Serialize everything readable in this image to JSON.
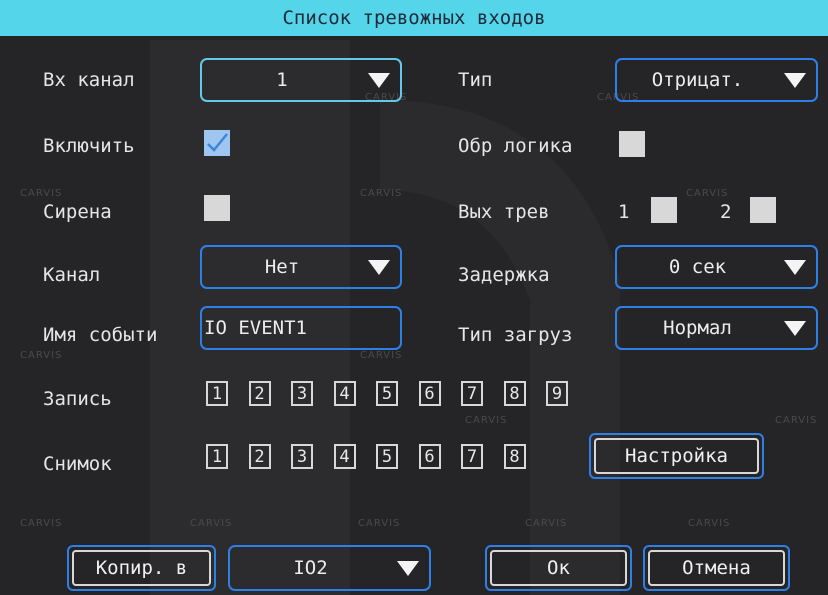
{
  "title": "Список тревожных входов",
  "labels": {
    "input_channel": "Вх канал",
    "enable": "Включить",
    "siren": "Сирена",
    "channel": "Канал",
    "event_name": "Имя событи",
    "record": "Запись",
    "snapshot": "Снимок",
    "type": "Тип",
    "reverse_logic": "Обр логика",
    "alarm_out": "Вых трев",
    "delay": "Задержка",
    "upload_type": "Тип загруз"
  },
  "values": {
    "input_channel": "1",
    "type": "Отрицат.",
    "channel": "Нет",
    "delay": "0 сек",
    "event_name": "IO EVENT1",
    "upload_type": "Нормал",
    "copy_target": "IO2"
  },
  "alarm_outputs": [
    "1",
    "2"
  ],
  "record_channels": [
    "1",
    "2",
    "3",
    "4",
    "5",
    "6",
    "7",
    "8",
    "9"
  ],
  "snapshot_channels": [
    "1",
    "2",
    "3",
    "4",
    "5",
    "6",
    "7",
    "8"
  ],
  "buttons": {
    "setup": "Настройка",
    "copy_to": "Копир. в",
    "ok": "Ок",
    "cancel": "Отмена"
  },
  "state": {
    "enable_checked": true,
    "siren_checked": false,
    "reverse_logic_checked": false,
    "alarm_out_1_checked": false,
    "alarm_out_2_checked": false
  },
  "watermark": "CARVIS",
  "colors": {
    "title_bg": "#55d5e9",
    "background": "#252527",
    "accent_border": "#2f7fe8",
    "selected_border": "#62c9ea"
  }
}
